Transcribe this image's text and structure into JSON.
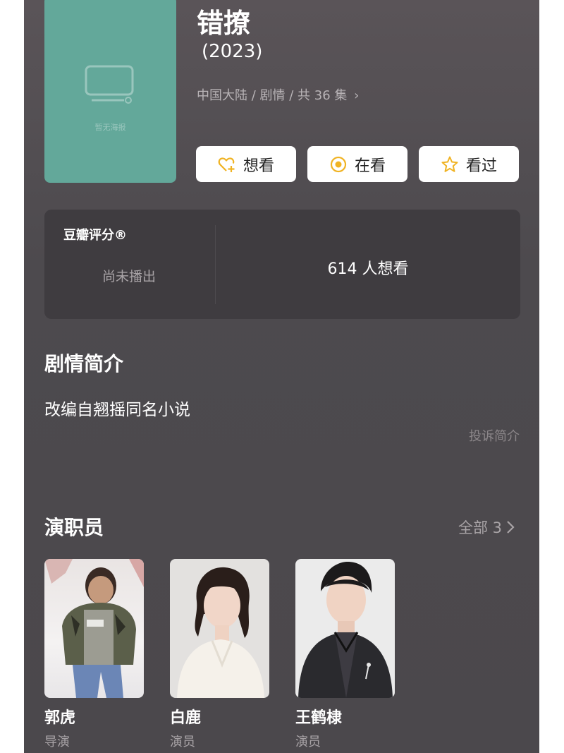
{
  "show": {
    "title": "错撩",
    "year": "(2023)",
    "meta": "中国大陆 / 剧情 / 共 36 集",
    "poster_icon": "tv-icon",
    "poster_watermark": "暂无海报"
  },
  "actions": [
    {
      "label": "想看",
      "icon": "heart-plus-icon"
    },
    {
      "label": "在看",
      "icon": "target-circle-icon"
    },
    {
      "label": "看过",
      "icon": "star-icon"
    }
  ],
  "rating": {
    "label": "豆瓣评分®",
    "status": "尚未播出",
    "want_count": "614 人想看"
  },
  "synopsis": {
    "heading": "剧情简介",
    "text": "改编自翘摇同名小说",
    "report_link": "投诉简介"
  },
  "cast": {
    "heading": "演职员",
    "all_link": "全部 3",
    "members": [
      {
        "name": "郭虎",
        "role": "导演"
      },
      {
        "name": "白鹿",
        "role": "演员"
      },
      {
        "name": "王鹤棣",
        "role": "演员"
      }
    ]
  },
  "colors": {
    "background": "#4b484c",
    "card": "#3f3c40",
    "poster": "#63a89a",
    "accent": "#f0b323"
  }
}
